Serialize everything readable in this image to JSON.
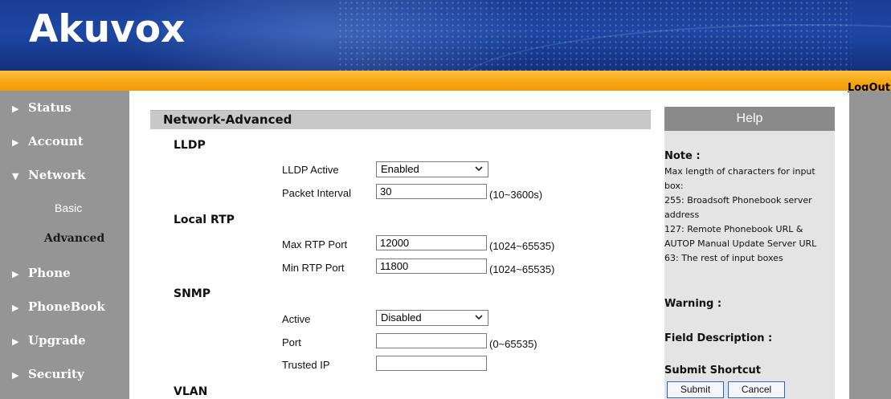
{
  "header": {
    "logo_text": "Akuvox",
    "logout_label": "LogOut"
  },
  "sidebar": {
    "items": [
      {
        "label": "Status",
        "expanded": false
      },
      {
        "label": "Account",
        "expanded": false
      },
      {
        "label": "Network",
        "expanded": true
      },
      {
        "label": "Basic",
        "sub": true,
        "selected": false
      },
      {
        "label": "Advanced",
        "sub": true,
        "selected": true
      },
      {
        "label": "Phone",
        "expanded": false
      },
      {
        "label": "PhoneBook",
        "expanded": false
      },
      {
        "label": "Upgrade",
        "expanded": false
      },
      {
        "label": "Security",
        "expanded": false
      }
    ]
  },
  "main": {
    "title": "Network-Advanced",
    "lldp": {
      "title": "LLDP",
      "active_label": "LLDP Active",
      "active_value": "Enabled",
      "interval_label": "Packet Interval",
      "interval_value": "30",
      "interval_hint": "(10~3600s)"
    },
    "rtp": {
      "title": "Local RTP",
      "max_label": "Max RTP Port",
      "max_value": "12000",
      "max_hint": "(1024~65535)",
      "min_label": "Min RTP Port",
      "min_value": "11800",
      "min_hint": "(1024~65535)"
    },
    "snmp": {
      "title": "SNMP",
      "active_label": "Active",
      "active_value": "Disabled",
      "port_label": "Port",
      "port_value": "",
      "port_hint": "(0~65535)",
      "trusted_label": "Trusted IP",
      "trusted_value": ""
    },
    "vlan": {
      "title": "VLAN"
    }
  },
  "help": {
    "title": "Help",
    "note_heading": "Note :",
    "note_lines": [
      "Max length of characters for input",
      "box:",
      "255: Broadsoft Phonebook server",
      "address",
      "127: Remote Phonebook URL &",
      "AUTOP Manual Update Server URL",
      "63: The rest of input boxes"
    ],
    "warning_heading": "Warning :",
    "field_desc_heading": "Field Description :",
    "shortcut_heading": "Submit Shortcut",
    "submit_label": "Submit",
    "cancel_label": "Cancel"
  },
  "colors": {
    "header_blue": "#1d47a3",
    "orange_bar": "#f7a511",
    "sidebar_gray": "#959595",
    "section_header_gray": "#c8c8c8",
    "help_header_gray": "#8a8a8a",
    "help_body_gray": "#e4e4e4",
    "selected_sub_text": "#1a1a1a"
  },
  "icons": {
    "collapsed": "triangle-right-icon",
    "expanded": "triangle-down-icon",
    "select": "chevron-down-icon"
  }
}
